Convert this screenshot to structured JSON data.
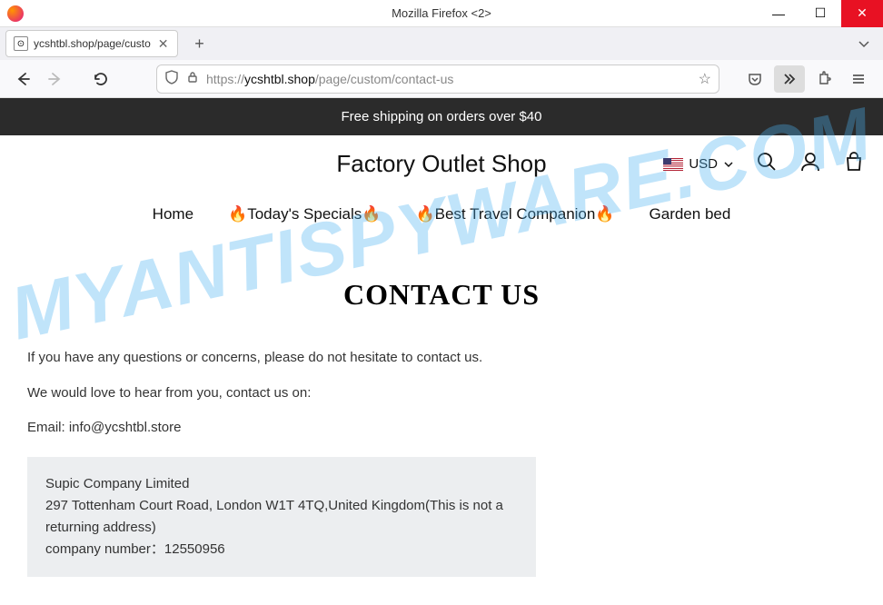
{
  "window": {
    "title": "Mozilla Firefox <2>"
  },
  "tab": {
    "label": "ycshtbl.shop/page/custo"
  },
  "url": {
    "protocol": "https://",
    "host": "ycshtbl.shop",
    "path": "/page/custom/contact-us"
  },
  "banner": {
    "text": "Free shipping on orders over $40"
  },
  "header": {
    "shop_title": "Factory Outlet Shop",
    "currency_label": "USD"
  },
  "nav": {
    "items": [
      {
        "label": "Home",
        "prefix": "",
        "suffix": ""
      },
      {
        "label": "Today's Specials",
        "prefix": "🔥",
        "suffix": "🔥"
      },
      {
        "label": "Best Travel Companion",
        "prefix": "🔥",
        "suffix": "🔥"
      },
      {
        "label": "Garden bed",
        "prefix": "",
        "suffix": ""
      }
    ]
  },
  "content": {
    "heading": "CONTACT US",
    "para1": "If you have any questions or concerns, please do not hesitate to contact us.",
    "para2": "We would love to hear from you, contact us on:",
    "para3": "Email: info@ycshtbl.store",
    "address": {
      "line1": "Supic Company Limited",
      "line2": "297 Tottenham Court Road, London W1T 4TQ,United Kingdom(This is not a returning address)",
      "line3": "company number：12550956"
    }
  },
  "watermark": "MYANTISPYWARE.COM"
}
